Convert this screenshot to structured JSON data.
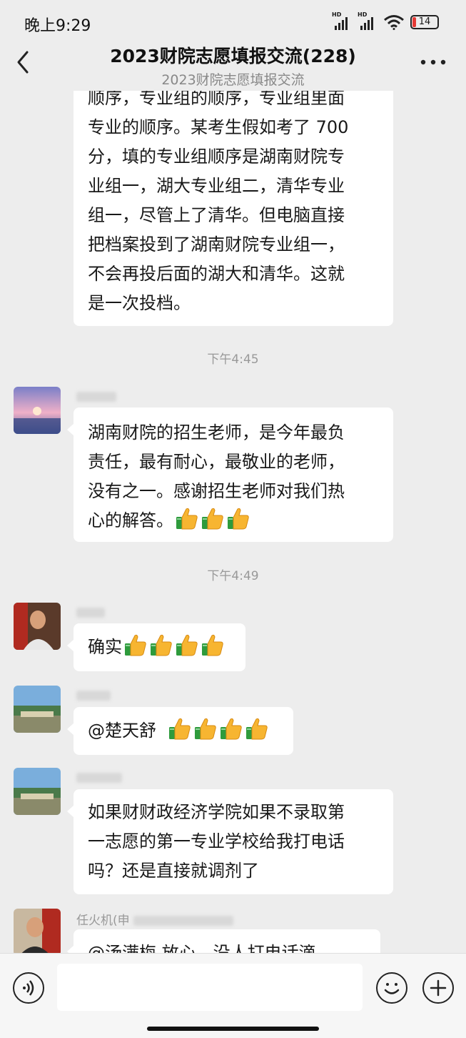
{
  "status_bar": {
    "time": "晚上9:29",
    "battery": "14",
    "signal_label": "HD"
  },
  "header": {
    "title": "2023财院志愿填报交流(228)",
    "subtitle": "2023财院志愿填报交流"
  },
  "messages": {
    "m0": {
      "lines": [
        "顺序，专业组的顺序，专业组里面",
        "专业的顺序。某考生假如考了 700",
        "分，填的专业组顺序是湖南财院专",
        "业组一，湖大专业组二，清华专业",
        "组一，尽管上了清华。但电脑直接",
        "把档案投到了湖南财院专业组一，",
        "不会再投后面的湖大和清华。这就",
        "是一次投档。"
      ]
    },
    "t1": "下午4:45",
    "m1": {
      "lines": [
        "湖南财院的招生老师，是今年最负",
        "责任，最有耐心，最敬业的老师，",
        "没有之一。感谢招生老师对我们热",
        "心的解答。"
      ],
      "emoji": "thumbs-up x3"
    },
    "t2": "下午4:49",
    "m2": {
      "text": "确实",
      "emoji": "thumbs-up x4"
    },
    "m3": {
      "text": "@楚天舒",
      "emoji": "thumbs-up x4"
    },
    "m4": {
      "lines": [
        "如果财财政经济学院如果不录取第",
        "一志愿的第一专业学校给我打电话",
        "吗？还是直接就调剂了"
      ]
    },
    "m5": {
      "sender": "任火机(申",
      "text": "@汤满梅   放心，没人打电话滴"
    }
  },
  "colors": {
    "background": "#ededed",
    "bubble": "#ffffff",
    "timestamp": "#999999"
  }
}
